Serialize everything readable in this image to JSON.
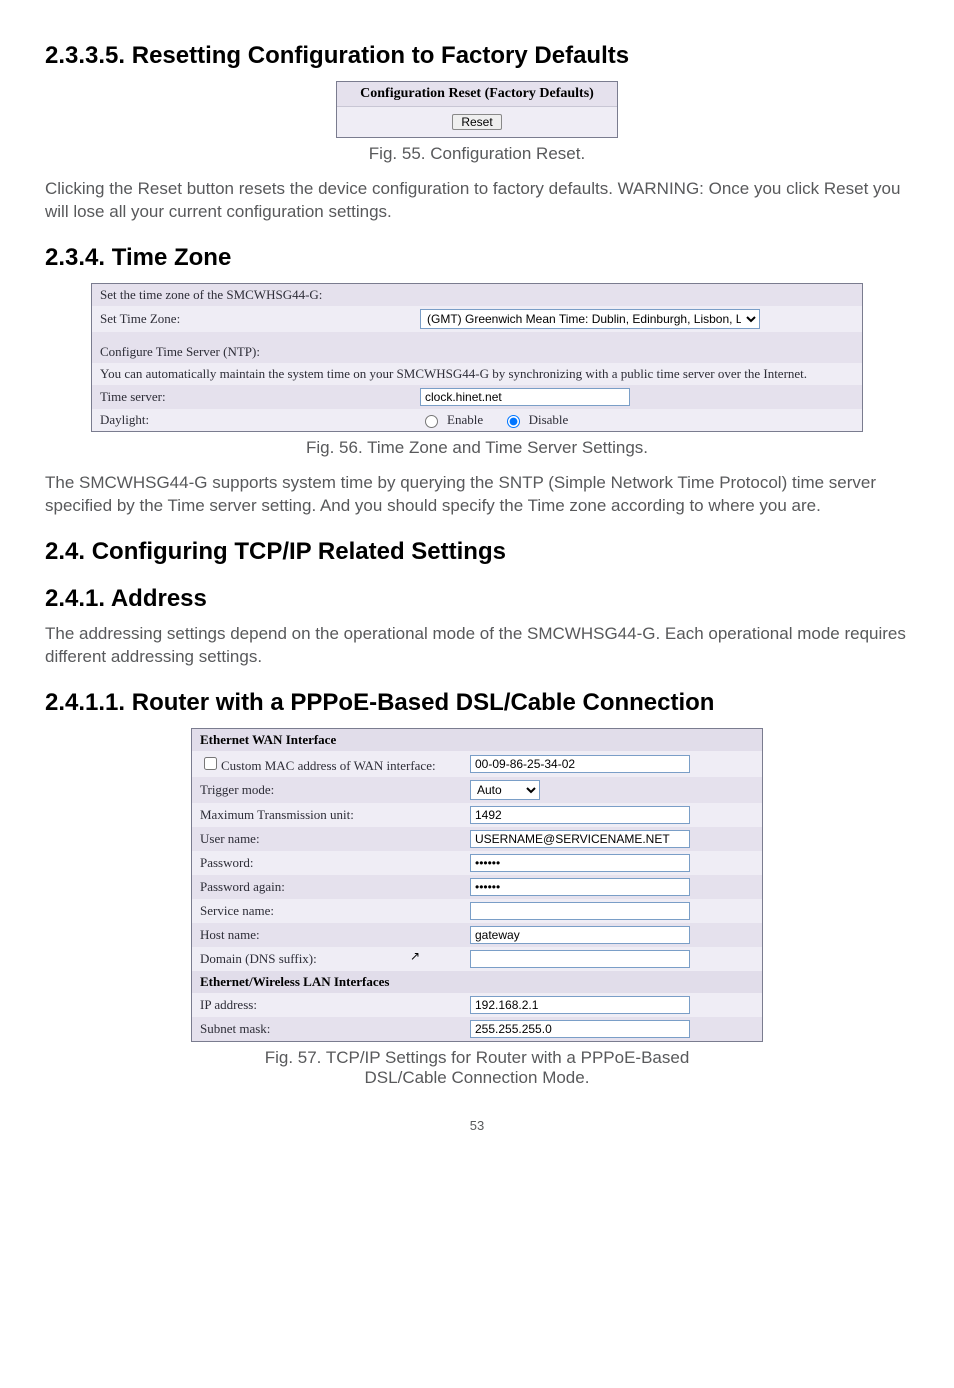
{
  "s1": {
    "heading": "2.3.3.5. Resetting Configuration to Factory Defaults",
    "fig55": {
      "title": "Configuration Reset (Factory Defaults)",
      "reset_label": "Reset"
    },
    "cap55": "Fig. 55. Configuration Reset.",
    "para": "Clicking the Reset button resets the device configuration to factory defaults. WARNING: Once you click Reset you will lose all your current configuration settings."
  },
  "s2": {
    "heading": "2.3.4. Time Zone",
    "fig56": {
      "r1": "Set the time zone of the SMCWHSG44-G:",
      "r2l": "Set Time Zone:",
      "r2v": "(GMT) Greenwich Mean Time: Dublin, Edinburgh, Lisbon, London",
      "r3": "Configure Time Server (NTP):",
      "r4": "You can automatically maintain the system time on your SMCWHSG44-G by synchronizing with a public time server over the Internet.",
      "r5l": "Time server:",
      "r5v": "clock.hinet.net",
      "r6l": "Daylight:",
      "r6a": "Enable",
      "r6b": "Disable"
    },
    "cap56": "Fig. 56. Time Zone and Time Server Settings.",
    "para": "The SMCWHSG44-G supports system time by querying the SNTP (Simple Network Time Protocol) time server specified by the Time server setting. And you should specify the Time zone according to where you are."
  },
  "s3": {
    "heading": "2.4. Configuring TCP/IP Related Settings",
    "sub": "2.4.1. Address",
    "para": "The addressing settings depend on the operational mode of the SMCWHSG44-G. Each operational mode requires different addressing settings."
  },
  "s4": {
    "heading": "2.4.1.1. Router with a PPPoE-Based DSL/Cable Connection",
    "fig57": {
      "h1": "Ethernet WAN Interface",
      "r1l": "Custom MAC address of WAN interface:",
      "r1v": "00-09-86-25-34-02",
      "r2l": "Trigger mode:",
      "r2v": "Auto",
      "r3l": "Maximum Transmission unit:",
      "r3v": "1492",
      "r4l": "User name:",
      "r4v": "USERNAME@SERVICENAME.NET",
      "r5l": "Password:",
      "r5v": "••••••",
      "r6l": "Password again:",
      "r6v": "••••••",
      "r7l": "Service name:",
      "r7v": "",
      "r8l": "Host name:",
      "r8v": "gateway",
      "r9l": "Domain (DNS suffix):",
      "r9v": "",
      "h2": "Ethernet/Wireless LAN Interfaces",
      "r10l": "IP address:",
      "r10v": "192.168.2.1",
      "r11l": "Subnet mask:",
      "r11v": "255.255.255.0"
    },
    "cap57a": "Fig. 57. TCP/IP Settings for Router with a PPPoE-Based",
    "cap57b": "DSL/Cable Connection Mode."
  },
  "pgnum": "53"
}
